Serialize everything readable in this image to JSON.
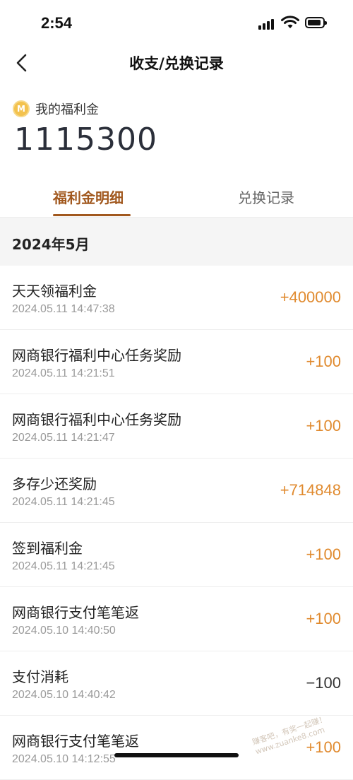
{
  "status_bar": {
    "time": "2:54"
  },
  "nav": {
    "title": "收支/兑换记录"
  },
  "balance": {
    "label": "我的福利金",
    "value": "1115300"
  },
  "tabs": [
    {
      "label": "福利金明细",
      "active": true
    },
    {
      "label": "兑换记录",
      "active": false
    }
  ],
  "month": "2024年5月",
  "records": [
    {
      "title": "天天领福利金",
      "time": "2024.05.11 14:47:38",
      "amount": "+400000"
    },
    {
      "title": "网商银行福利中心任务奖励",
      "time": "2024.05.11 14:21:51",
      "amount": "+100"
    },
    {
      "title": "网商银行福利中心任务奖励",
      "time": "2024.05.11 14:21:47",
      "amount": "+100"
    },
    {
      "title": "多存少还奖励",
      "time": "2024.05.11 14:21:45",
      "amount": "+714848"
    },
    {
      "title": "签到福利金",
      "time": "2024.05.11 14:21:45",
      "amount": "+100"
    },
    {
      "title": "网商银行支付笔笔返",
      "time": "2024.05.10 14:40:50",
      "amount": "+100"
    },
    {
      "title": "支付消耗",
      "time": "2024.05.10 14:40:42",
      "amount": "−100"
    },
    {
      "title": "网商银行支付笔笔返",
      "time": "2024.05.10 14:12:55",
      "amount": "+100"
    }
  ],
  "watermark": "赚客吧，有奖一起赚！www.zuanke8.com",
  "colors": {
    "accent": "#a1581e",
    "amount_positive": "#e08a2e",
    "amount_negative": "#333333"
  }
}
